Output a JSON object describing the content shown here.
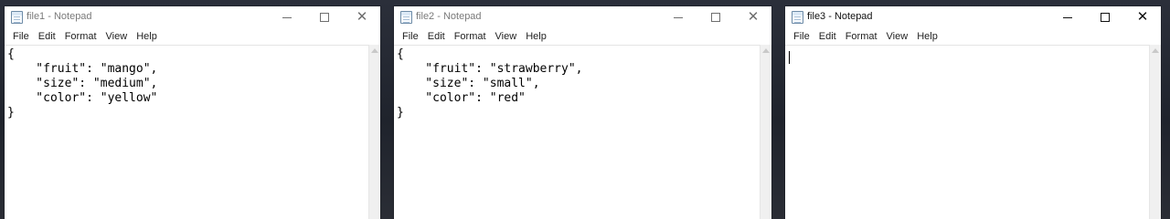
{
  "menu_labels": [
    "File",
    "Edit",
    "Format",
    "View",
    "Help"
  ],
  "windows": [
    {
      "title": "file1 - Notepad",
      "content": "{\n    \"fruit\": \"mango\",\n    \"size\": \"medium\",\n    \"color\": \"yellow\"\n}"
    },
    {
      "title": "file2 - Notepad",
      "content": "{\n    \"fruit\": \"strawberry\",\n    \"size\": \"small\",\n    \"color\": \"red\"\n}"
    },
    {
      "title": "file3 - Notepad",
      "content": ""
    }
  ],
  "icons": {
    "app": "notepad-icon",
    "minimize": "minimize-icon",
    "maximize": "maximize-icon",
    "close": "close-icon",
    "scroll_up": "chevron-up-icon"
  },
  "colors": {
    "inactive_title": "#7a7a7a",
    "active_title": "#111111",
    "window_background": "#ffffff"
  }
}
